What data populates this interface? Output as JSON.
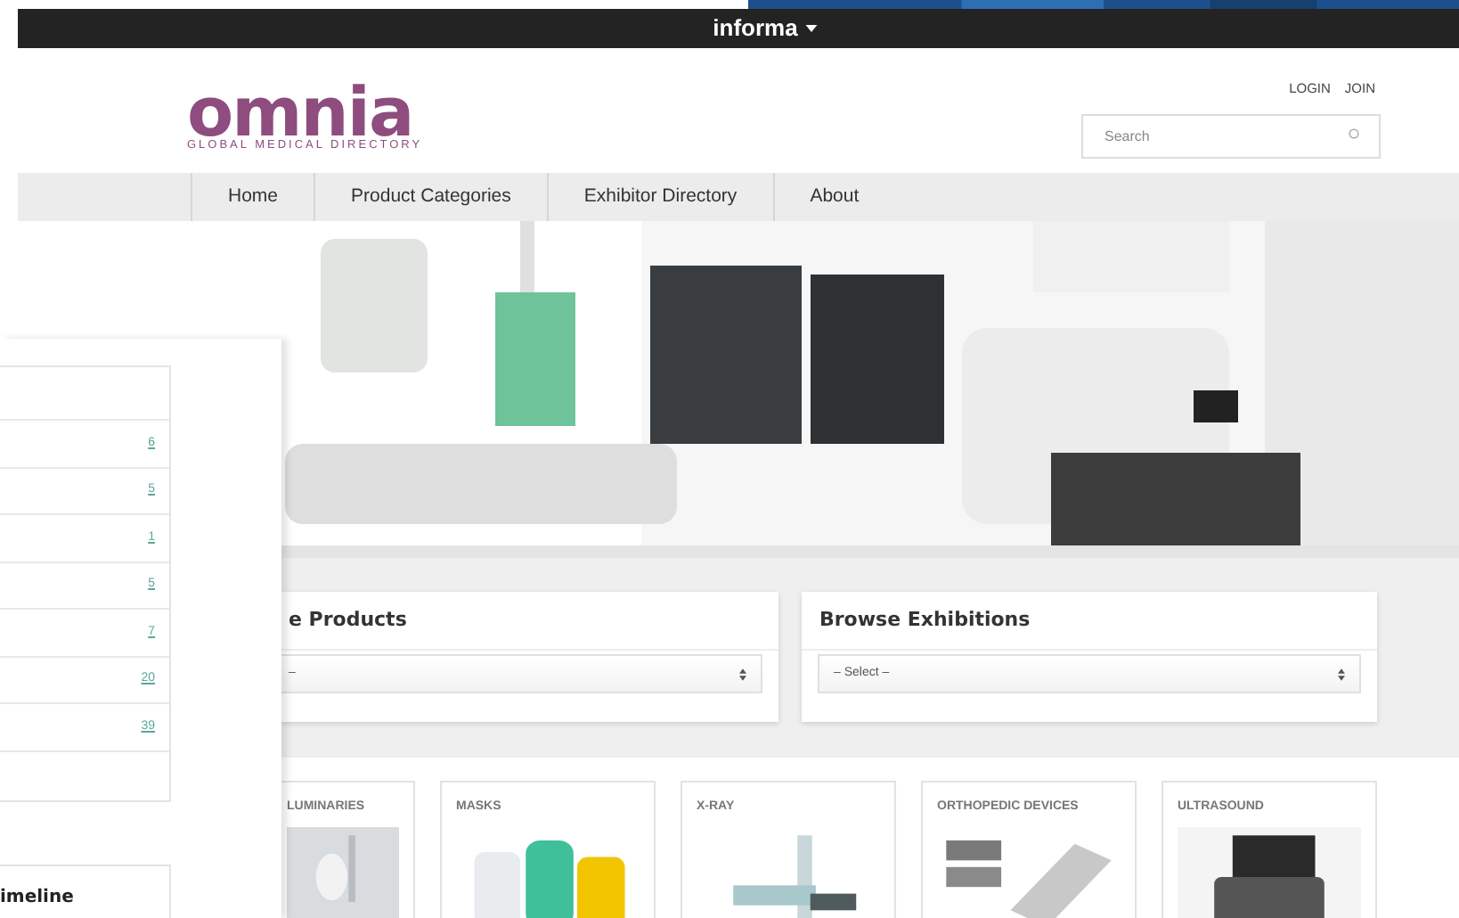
{
  "top_bar": {
    "brand": "informa"
  },
  "header": {
    "logo": {
      "wordmark": "omnia",
      "tagline": "GLOBAL MEDICAL DIRECTORY"
    },
    "account_links": [
      "LOGIN",
      "JOIN"
    ],
    "search": {
      "placeholder": "Search"
    }
  },
  "nav": {
    "items": [
      "Home",
      "Product Categories",
      "Exhibitor Directory",
      "About"
    ]
  },
  "browse_cards": [
    {
      "title": "e Products",
      "select": "–"
    },
    {
      "title": "Browse Exhibitions",
      "select": "– Select –"
    }
  ],
  "categories": [
    "LUMINARIES",
    "MASKS",
    "X-RAY",
    "ORTHOPEDIC DEVICES",
    "ULTRASOUND"
  ],
  "side_panel": {
    "counts": [
      "6",
      "5",
      "1",
      "5",
      "7",
      "20",
      "39"
    ],
    "timeline_title": "imeline"
  }
}
